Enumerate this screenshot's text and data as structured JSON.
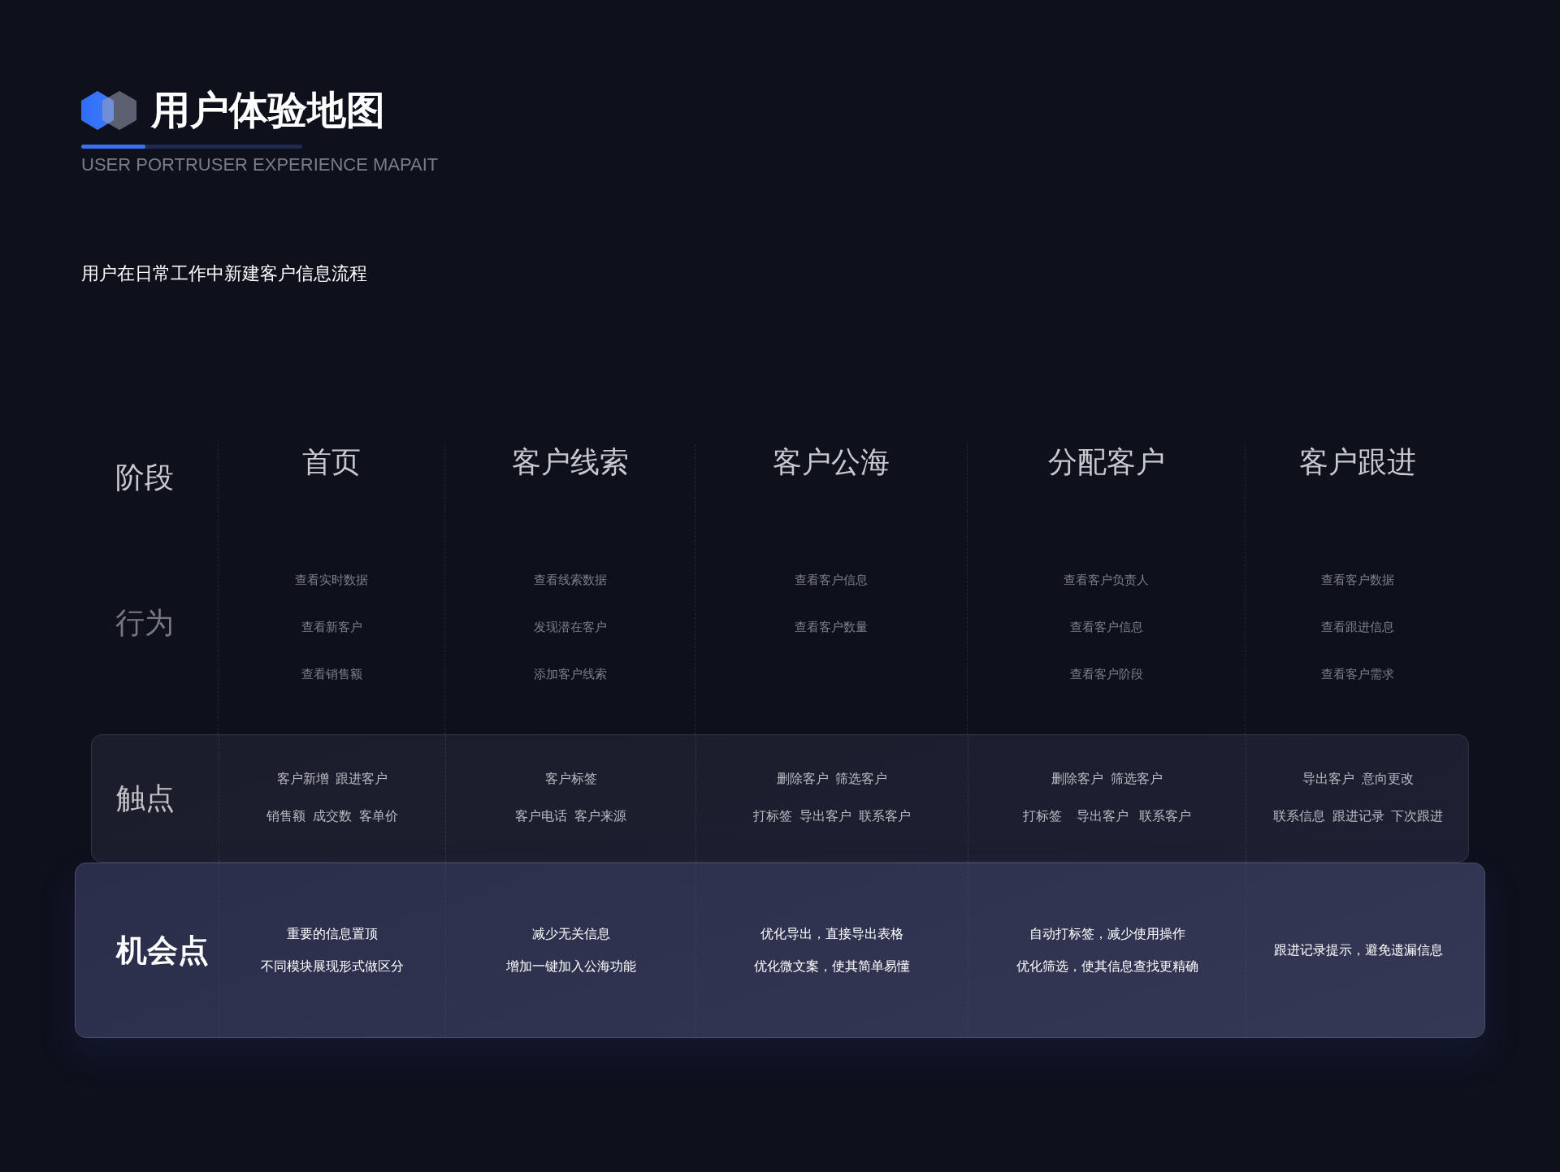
{
  "title": "用户体验地图",
  "title_bar": {
    "level": 0.29
  },
  "subtitle": "USER PORTRUSER EXPERIENCE MAPAIT",
  "description": "用户在日常工作中新建客户信息流程",
  "stage_header": {
    "label": "阶段",
    "stages": [
      "首页",
      "客户线索",
      "客户公海",
      "分配客户",
      "客户跟进"
    ]
  },
  "rows": [
    {
      "kind": "behavior",
      "label": "行为",
      "cells": [
        [
          "查看实时数据",
          "查看新客户",
          "查看销售额"
        ],
        [
          "查看线索数据",
          "发现潜在客户",
          "添加客户线索"
        ],
        [
          "查看客户信息",
          "查看客户数量"
        ],
        [
          "查看客户负责人",
          "查看客户信息",
          "查看客户阶段"
        ],
        [
          "查看客户数据",
          "查看跟进信息",
          "查看客户需求"
        ]
      ]
    },
    {
      "kind": "touchpoint",
      "label": "触点",
      "cells": [
        [
          "客户新增  跟进客户",
          "销售额  成交数  客单价"
        ],
        [
          "客户标签",
          "客户电话  客户来源"
        ],
        [
          "删除客户  筛选客户",
          "打标签  导出客户  联系客户"
        ],
        [
          "删除客户  筛选客户",
          "打标签    导出客户   联系客户"
        ],
        [
          "导出客户  意向更改",
          "联系信息  跟进记录  下次跟进"
        ]
      ]
    },
    {
      "kind": "opportunity",
      "label": "机会点",
      "cells": [
        [
          "重要的信息置顶",
          "不同模块展现形式做区分"
        ],
        [
          "减少无关信息",
          "增加一键加入公海功能"
        ],
        [
          "优化导出，直接导出表格",
          "优化微文案，使其简单易懂"
        ],
        [
          "自动打标签，减少使用操作",
          "优化筛选，使其信息查找更精确"
        ],
        [
          "跟进记录提示，避免遗漏信息"
        ]
      ]
    }
  ]
}
